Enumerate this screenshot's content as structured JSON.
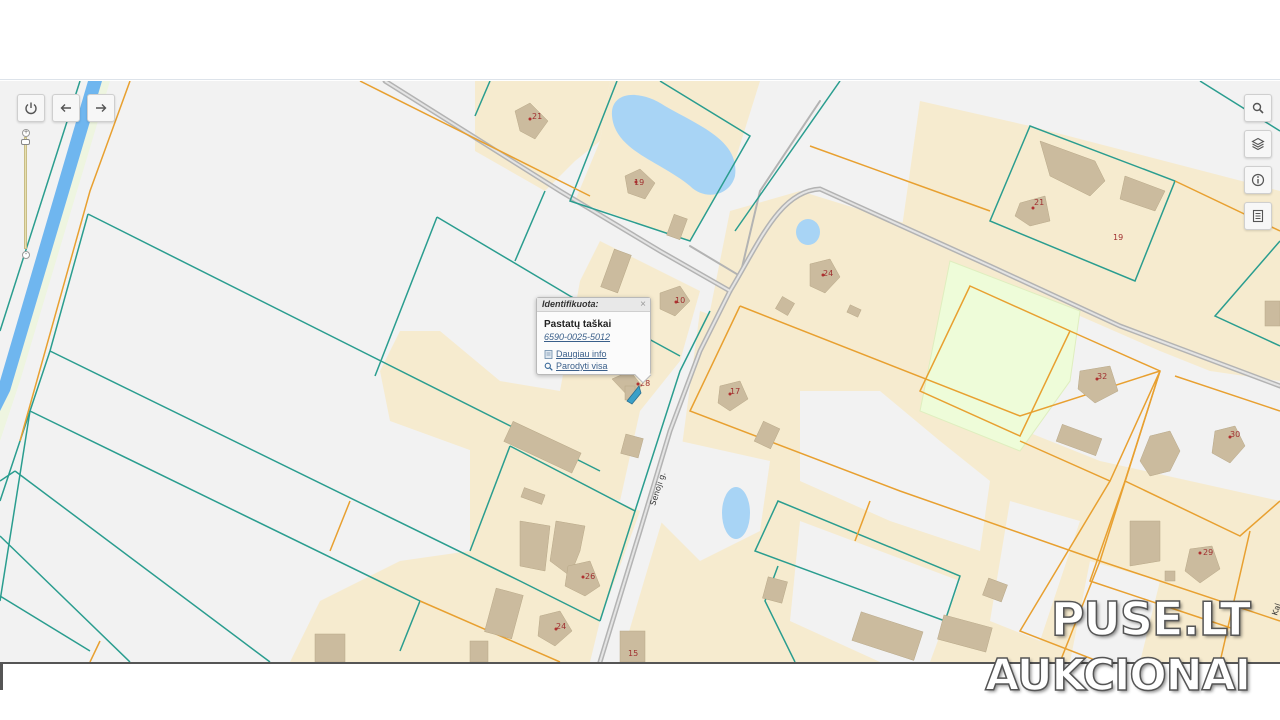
{
  "map": {
    "toolbar_left": [
      {
        "name": "power-button",
        "icon": "power-icon"
      },
      {
        "name": "back-button",
        "icon": "arrow-left-icon"
      },
      {
        "name": "forward-button",
        "icon": "arrow-right-icon"
      }
    ],
    "toolbar_right": [
      {
        "name": "search-button",
        "icon": "search-icon"
      },
      {
        "name": "layers-button",
        "icon": "layers-icon"
      },
      {
        "name": "info-button",
        "icon": "info-icon"
      },
      {
        "name": "legend-button",
        "icon": "document-icon"
      }
    ],
    "zoom": {
      "plus": "+",
      "minus": "-"
    },
    "street_label": "Senoji g.",
    "parcel_numbers": {
      "n21a": "21",
      "n19a": "19",
      "n10": "10",
      "n28": "28",
      "n26": "26",
      "n24a": "24",
      "n15": "15",
      "n17": "17",
      "n24b": "24",
      "n21b": "21",
      "n19b": "19",
      "n32": "32",
      "n30": "30",
      "n29": "29"
    },
    "edge_label": "Kal",
    "colors": {
      "parcel_border": "#2a9d8f",
      "building_border": "#e8a030",
      "building_area": "#f6ebcf",
      "building": "#cbbb9e",
      "water": "#a8d4f5",
      "road": "#b3b3b3",
      "canal": "#6fb6ef",
      "green_area": "#eefcd9"
    }
  },
  "popup": {
    "title": "Identifikuota:",
    "close": "×",
    "layer": "Pastatų taškai",
    "code": "6590-0025-5012",
    "more_info": "Daugiau info",
    "show_all": "Parodyti visa"
  },
  "watermark": {
    "line1": "PUSE.LT",
    "line2": "AUKCIONAI"
  }
}
